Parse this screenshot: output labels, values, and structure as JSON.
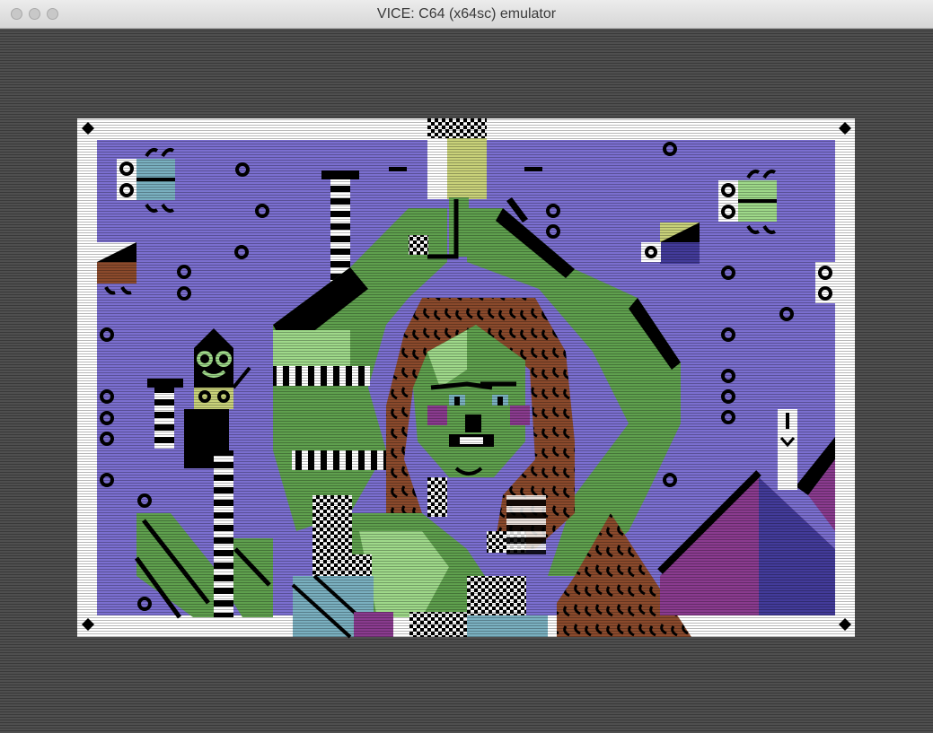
{
  "window": {
    "title": "VICE: C64 (x64sc) emulator",
    "buttons": [
      "close",
      "minimize",
      "zoom"
    ]
  },
  "screen": {
    "description_icon": "c64-artwork-display",
    "palette": {
      "border": "#4f4f4f",
      "frame": "#ffffff",
      "background": "#7b6fd0",
      "green": "#5fa04e",
      "light_green": "#9fd98a",
      "brown": "#8b4a2c",
      "purple": "#8a3b8f",
      "dark_purple": "#433b9a",
      "cyan": "#7ab0c0",
      "yellow": "#c9d27a",
      "black": "#000000"
    }
  }
}
